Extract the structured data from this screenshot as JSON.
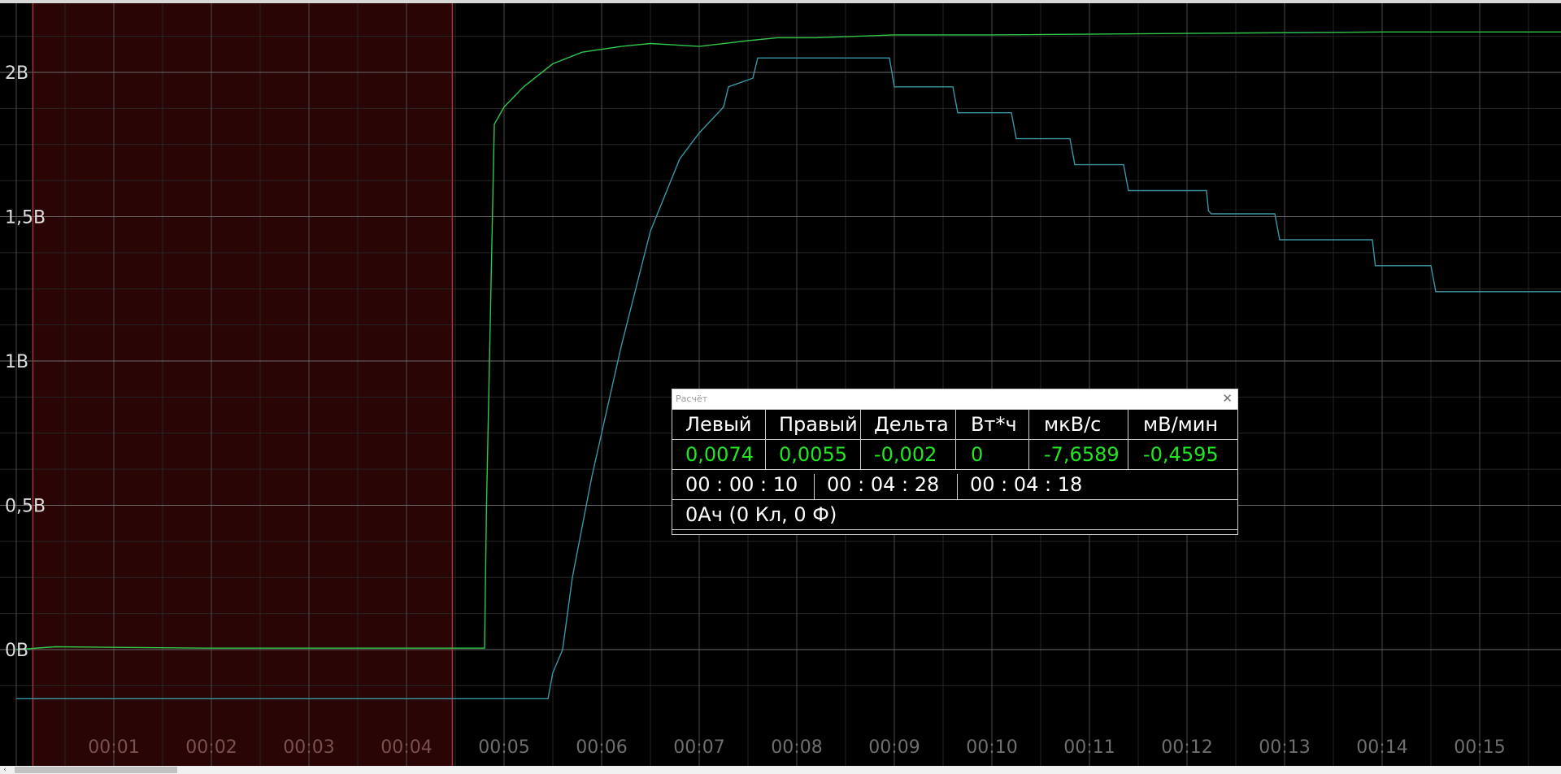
{
  "chart_data": {
    "type": "line",
    "x_range": [
      0,
      16
    ],
    "y_range": [
      -0.2,
      2.2
    ],
    "y_ticks": [
      {
        "value": 2.0,
        "label": "2В"
      },
      {
        "value": 1.5,
        "label": "1,5В"
      },
      {
        "value": 1.0,
        "label": "1В"
      },
      {
        "value": 0.5,
        "label": "0,5В"
      },
      {
        "value": 0.0,
        "label": "0В"
      }
    ],
    "x_ticks": [
      {
        "value": 1,
        "label": "00:01"
      },
      {
        "value": 2,
        "label": "00:02"
      },
      {
        "value": 3,
        "label": "00:03"
      },
      {
        "value": 4,
        "label": "00:04"
      },
      {
        "value": 5,
        "label": "00:05"
      },
      {
        "value": 6,
        "label": "00:06"
      },
      {
        "value": 7,
        "label": "00:07"
      },
      {
        "value": 8,
        "label": "00:08"
      },
      {
        "value": 9,
        "label": "00:09"
      },
      {
        "value": 10,
        "label": "00:10"
      },
      {
        "value": 11,
        "label": "00:11"
      },
      {
        "value": 12,
        "label": "00:12"
      },
      {
        "value": 13,
        "label": "00:13"
      },
      {
        "value": 14,
        "label": "00:14"
      },
      {
        "value": 15,
        "label": "00:15"
      }
    ],
    "selection": {
      "start": 0.17,
      "end": 4.47
    },
    "series": [
      {
        "color": "#2fc64a",
        "x": [
          0,
          0.4,
          2,
          4.8,
          4.82,
          4.9,
          5.0,
          5.2,
          5.5,
          5.8,
          6.2,
          6.5,
          7.0,
          7.5,
          7.8,
          8.2,
          9.0,
          10.0,
          12.0,
          14.0,
          16.0
        ],
        "y": [
          0,
          0.01,
          0.005,
          0.005,
          0.5,
          1.82,
          1.88,
          1.95,
          2.03,
          2.07,
          2.09,
          2.1,
          2.09,
          2.11,
          2.12,
          2.12,
          2.13,
          2.13,
          2.135,
          2.14,
          2.14
        ]
      },
      {
        "color": "#3b96a4",
        "x": [
          0,
          5.45,
          5.5,
          5.6,
          5.7,
          5.9,
          6.2,
          6.5,
          6.8,
          7.0,
          7.25,
          7.3,
          7.55,
          7.6,
          8.95,
          9.0,
          9.6,
          9.65,
          10.2,
          10.25,
          10.8,
          10.85,
          11.35,
          11.4,
          12.2,
          12.22,
          12.25,
          12.9,
          12.95,
          13.9,
          13.93,
          13.96,
          14.5,
          14.55,
          16.0
        ],
        "y": [
          -0.17,
          -0.17,
          -0.08,
          0,
          0.25,
          0.6,
          1.05,
          1.45,
          1.7,
          1.79,
          1.88,
          1.95,
          1.98,
          2.05,
          2.05,
          1.95,
          1.95,
          1.86,
          1.86,
          1.77,
          1.77,
          1.68,
          1.68,
          1.59,
          1.59,
          1.52,
          1.51,
          1.51,
          1.42,
          1.42,
          1.33,
          1.33,
          1.33,
          1.24,
          1.24
        ]
      }
    ]
  },
  "calc": {
    "title": "Расчёт",
    "close_glyph": "✕",
    "headers": [
      "Левый",
      "Правый",
      "Дельта",
      "Вт*ч",
      "мкВ/с",
      "мВ/мин"
    ],
    "values": [
      "0,0074",
      "0,0055",
      "-0,002",
      "0",
      "-7,6589",
      "-0,4595"
    ],
    "times": [
      "00 : 00 : 10",
      "00 : 04 : 28",
      "00 : 04 : 18"
    ],
    "charge": "0Ач (0 Кл, 0 Ф)"
  },
  "scrollbar": {
    "arrow": "‹"
  }
}
